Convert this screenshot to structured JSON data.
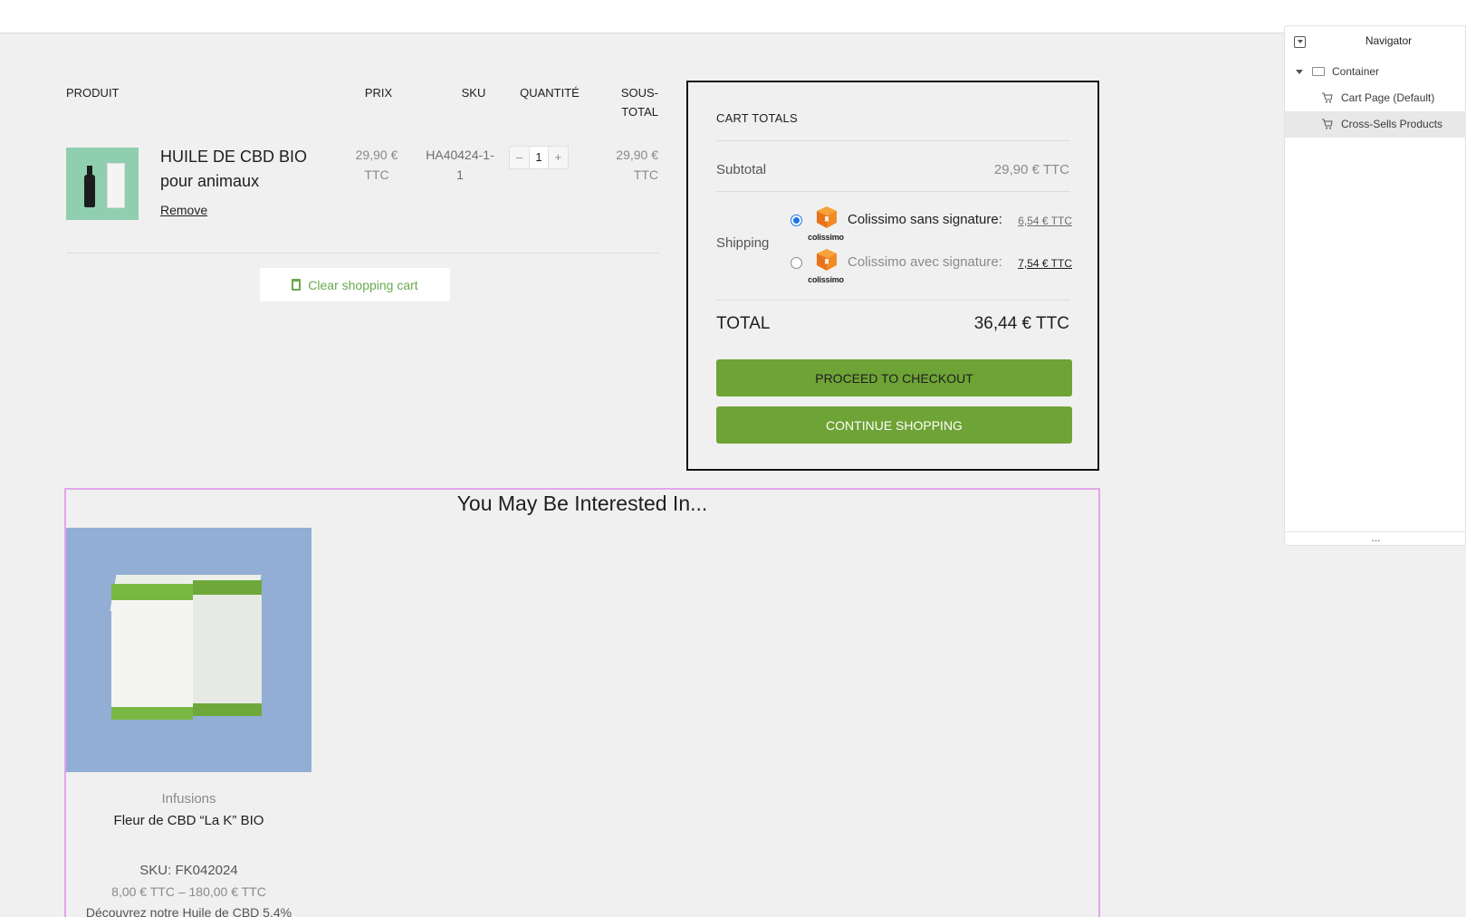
{
  "cart": {
    "headers": {
      "product": "PRODUIT",
      "price": "PRIX",
      "sku": "SKU",
      "quantity": "QUANTITÉ",
      "subtotal_l1": "SOUS-",
      "subtotal_l2": "TOTAL"
    },
    "items": [
      {
        "name": "HUILE DE CBD BIO pour animaux",
        "remove": "Remove",
        "price_l1": "29,90 €",
        "price_l2": "TTC",
        "sku_l1": "HA40424-1-",
        "sku_l2": "1",
        "qty": "1",
        "subtotal_l1": "29,90 €",
        "subtotal_l2": "TTC",
        "minus": "–",
        "plus": "+"
      }
    ],
    "clear_label": "Clear shopping cart"
  },
  "totals": {
    "title": "CART TOTALS",
    "subtotal_label": "Subtotal",
    "subtotal_value": "29,90 € TTC",
    "shipping_label": "Shipping",
    "shipping_options": [
      {
        "name": "Colissimo sans signature:",
        "price": "6,54 € TTC",
        "selected": true,
        "logo": "colissimo",
        "color": "#1e1e1e"
      },
      {
        "name": "Colissimo avec signature:",
        "price": "7,54 € TTC",
        "selected": false,
        "logo": "colissimo",
        "color": "#8a8a8a"
      }
    ],
    "total_label": "TOTAL",
    "total_value": "36,44 € TTC",
    "checkout_label": "Proceed to checkout",
    "continue_label": "Continue shopping",
    "accent_color": "#6ea335"
  },
  "cross_sells": {
    "title": "You May Be Interested In...",
    "products": [
      {
        "category": "Infusions",
        "name": "Fleur de CBD “La K” BIO",
        "sku": "SKU: FK042024",
        "price": "8,00 € TTC – 180,00 € TTC",
        "description": "Découvrez notre Huile de CBD 5,4%"
      }
    ]
  },
  "navigator": {
    "title": "Navigator",
    "items": [
      {
        "label": "Container",
        "icon": "container-icon",
        "expanded": true
      },
      {
        "label": "Cart Page (Default)",
        "icon": "cart-icon"
      },
      {
        "label": "Cross-Sells Products",
        "icon": "cart-icon",
        "active": true
      }
    ],
    "footer": "..."
  }
}
